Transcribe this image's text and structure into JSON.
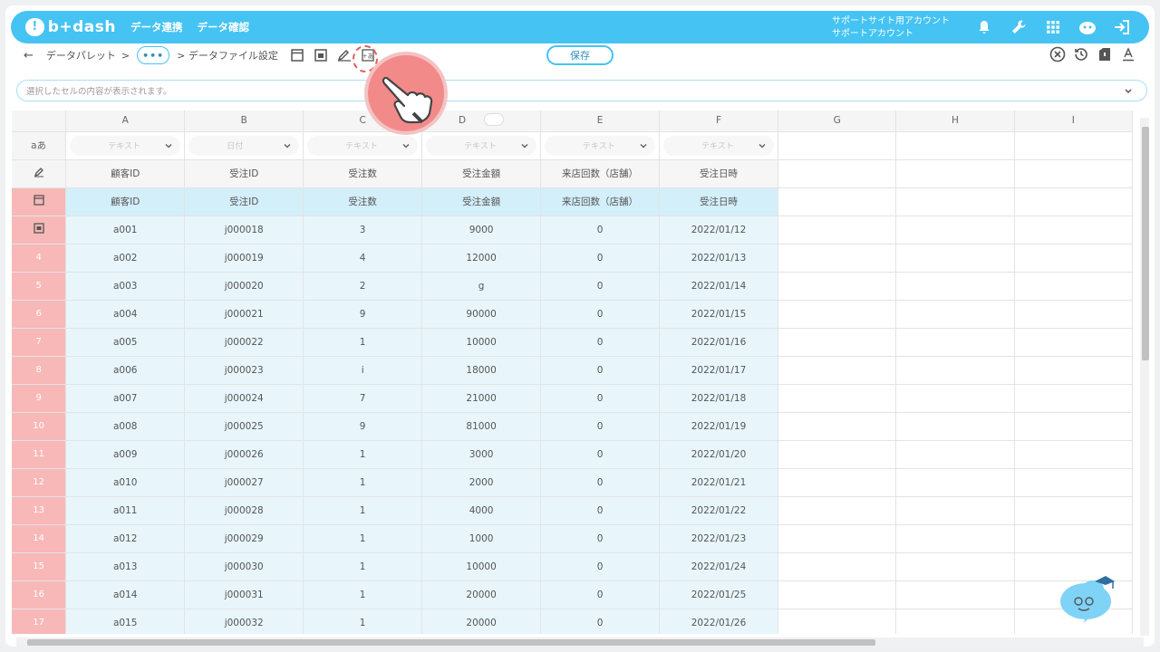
{
  "app": {
    "logo_text": "b+dash",
    "nav": [
      "データ連携",
      "データ確認"
    ],
    "account_line1": "サポートサイト用アカウント",
    "account_line2": "サポートアカウント",
    "icons": [
      "bell-icon",
      "wrench-icon",
      "grid-menu-icon",
      "ai-assistant-icon",
      "logout-icon"
    ]
  },
  "toolbar": {
    "back_label": "←",
    "crumb1": "データパレット",
    "crumb_sep": ">",
    "dots_label": "•••",
    "crumb2": "> データファイル設定",
    "save_label": "保存"
  },
  "cellbar": {
    "placeholder": "選択したセルの内容が表示されます。"
  },
  "grid": {
    "columns": [
      "A",
      "B",
      "C",
      "D",
      "E",
      "F",
      "G",
      "H",
      "I"
    ],
    "type_row_label": "aあ",
    "types": [
      "テキスト",
      "日付",
      "テキスト",
      "テキスト",
      "テキスト",
      "テキスト"
    ],
    "header_names": [
      "顧客ID",
      "受注ID",
      "受注数",
      "受注金額",
      "来店回数（店舗）",
      "受注日時"
    ],
    "row_labels": [
      "4",
      "5",
      "6",
      "7",
      "8",
      "9",
      "10",
      "11",
      "12",
      "13",
      "14",
      "15",
      "16",
      "17"
    ],
    "rows": [
      [
        "a001",
        "j000018",
        "3",
        "9000",
        "0",
        "2022/01/12"
      ],
      [
        "a002",
        "j000019",
        "4",
        "12000",
        "0",
        "2022/01/13"
      ],
      [
        "a003",
        "j000020",
        "2",
        "g",
        "0",
        "2022/01/14"
      ],
      [
        "a004",
        "j000021",
        "9",
        "90000",
        "0",
        "2022/01/15"
      ],
      [
        "a005",
        "j000022",
        "1",
        "10000",
        "0",
        "2022/01/16"
      ],
      [
        "a006",
        "j000023",
        "i",
        "18000",
        "0",
        "2022/01/17"
      ],
      [
        "a007",
        "j000024",
        "7",
        "21000",
        "0",
        "2022/01/18"
      ],
      [
        "a008",
        "j000025",
        "9",
        "81000",
        "0",
        "2022/01/19"
      ],
      [
        "a009",
        "j000026",
        "1",
        "3000",
        "0",
        "2022/01/20"
      ],
      [
        "a010",
        "j000027",
        "1",
        "2000",
        "0",
        "2022/01/21"
      ],
      [
        "a011",
        "j000028",
        "1",
        "4000",
        "0",
        "2022/01/22"
      ],
      [
        "a012",
        "j000029",
        "1",
        "1000",
        "0",
        "2022/01/23"
      ],
      [
        "a013",
        "j000030",
        "1",
        "10000",
        "0",
        "2022/01/24"
      ],
      [
        "a014",
        "j000031",
        "1",
        "20000",
        "0",
        "2022/01/25"
      ],
      [
        "a015",
        "j000032",
        "1",
        "20000",
        "0",
        "2022/01/26"
      ]
    ]
  },
  "colors": {
    "accent": "#45c3f3",
    "row_header_red": "#f8b8b8",
    "data_fill": "#e8f6fc",
    "pointer": "#f38a8a"
  }
}
